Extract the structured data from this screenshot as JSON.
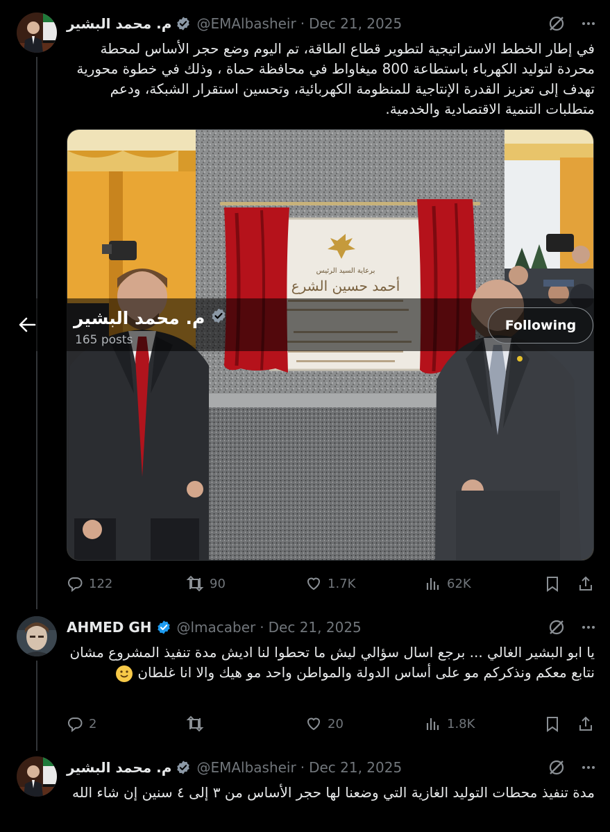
{
  "profile_bar": {
    "name": "م. محمد البشير",
    "posts": "165 posts",
    "follow_label": "Following"
  },
  "tweets": [
    {
      "name": "م. محمد البشير",
      "handle": "@EMAlbasheir",
      "date": "Dec 21, 2025",
      "text": "في إطار الخطط الاستراتيجية لتطوير قطاع الطاقة، تم اليوم وضع حجر الأساس لمحطة محردة لتوليد الكهرباء باستطاعة 800 ميغاواط في محافظة حماة ، وذلك في خطوة محورية تهدف إلى تعزيز القدرة الإنتاجية للمنظومة الكهربائية، وتحسين استقرار الشبكة، ودعم متطلبات التنمية الاقتصادية والخدمية.",
      "plaque": {
        "line1": "برعاية السيد الرئيس",
        "line2": "أحمد حسين الشرع"
      },
      "stats": {
        "replies": "122",
        "reposts": "90",
        "likes": "1.7K",
        "views": "62K"
      }
    },
    {
      "name": "AHMED GH",
      "handle": "@lmacaber",
      "date": "Dec 21, 2025",
      "text": "يا ابو البشير  الغالي ... برجع اسال سؤالي ليش ما تحطوا لنا اديش مدة تنفيذ المشروع مشان نتابع معكم ونذكركم مو على أساس الدولة والمواطن واحد مو هيك والا انا غلطان",
      "emoji": "slightly-smiling-face",
      "stats": {
        "replies": "2",
        "reposts": "",
        "likes": "20",
        "views": "1.8K"
      }
    },
    {
      "name": "م. محمد البشير",
      "handle": "@EMAlbasheir",
      "date": "Dec 21, 2025",
      "text": "مدة تنفيذ محطات التوليد الغازية التي وضعنا لها حجر الأساس من ٣ إلى ٤ سنين إن شاء الله"
    }
  ],
  "colors": {
    "background": "#000000",
    "text": "#e7e9ea",
    "muted": "#71767b",
    "verified": "#1d9bf0",
    "divider": "#2f3336"
  },
  "icons": [
    "grok-icon",
    "more-icon",
    "reply-icon",
    "repost-icon",
    "like-icon",
    "views-icon",
    "bookmark-icon",
    "share-icon",
    "back-arrow-icon",
    "verified-badge-icon"
  ]
}
